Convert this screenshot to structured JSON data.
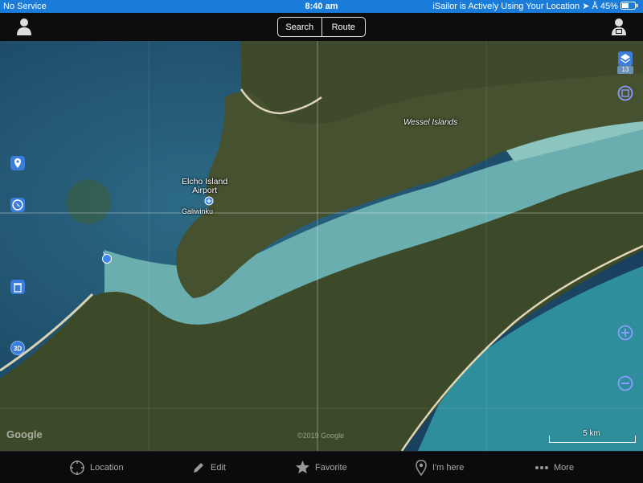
{
  "status_bar": {
    "carrier": "No Service",
    "time": "8:40 am",
    "location_notice": "iSailor is Actively Using Your Location",
    "battery": "45%"
  },
  "navbar": {
    "search_label": "Search",
    "route_label": "Route",
    "left_icon": "person-icon",
    "right_icon": "person-lock-icon"
  },
  "map": {
    "labels": {
      "airport": "Elcho Island\nAirport",
      "town": "Galiwinku",
      "islands": "Wessel Islands"
    },
    "layers_badge": "13",
    "scale_label": "5 km",
    "attribution": "Google",
    "copyright": "©2019 Google",
    "colors": {
      "deep_water": "#1e4d6b",
      "shallow_water": "#5fa3a6",
      "land": "#3d4a2a",
      "accent": "#3d84f0"
    }
  },
  "tabbar": {
    "items": [
      {
        "label": "Location",
        "icon": "crosshair-icon"
      },
      {
        "label": "Edit",
        "icon": "pencil-icon"
      },
      {
        "label": "Favorite",
        "icon": "star-icon"
      },
      {
        "label": "I'm here",
        "icon": "pin-icon"
      },
      {
        "label": "More",
        "icon": "more-dots-icon"
      }
    ]
  }
}
